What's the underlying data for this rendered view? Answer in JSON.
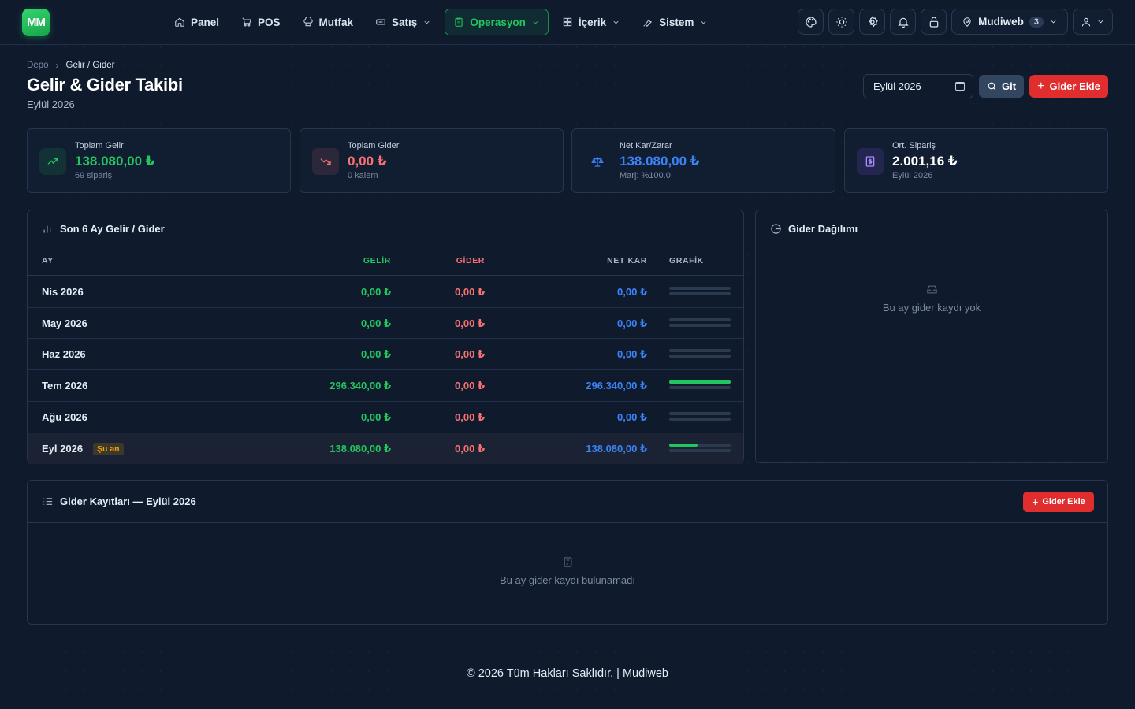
{
  "brand": {
    "logo_text": "MM",
    "accent": "#22c55e"
  },
  "nav": [
    {
      "label": "Panel",
      "icon": "home-icon",
      "has_dropdown": false,
      "active": false
    },
    {
      "label": "POS",
      "icon": "cart-icon",
      "has_dropdown": false,
      "active": false
    },
    {
      "label": "Mutfak",
      "icon": "chef-hat-icon",
      "has_dropdown": false,
      "active": false
    },
    {
      "label": "Satış",
      "icon": "ticket-icon",
      "has_dropdown": true,
      "active": false
    },
    {
      "label": "Operasyon",
      "icon": "clipboard-icon",
      "has_dropdown": true,
      "active": true
    },
    {
      "label": "İçerik",
      "icon": "grid-icon",
      "has_dropdown": true,
      "active": false
    },
    {
      "label": "Sistem",
      "icon": "wrench-icon",
      "has_dropdown": true,
      "active": false
    }
  ],
  "toolbar": {
    "icons": [
      "palette-icon",
      "sun-icon",
      "gear-icon",
      "bell-icon",
      "lock-icon"
    ],
    "branch_label": "Mudiweb",
    "branch_count": "3"
  },
  "breadcrumb": {
    "root": "Depo",
    "current": "Gelir / Gider"
  },
  "page": {
    "title": "Gelir & Gider Takibi",
    "subtitle": "Eylül 2026",
    "month_value": "Eylül 2026",
    "go_label": "Git",
    "add_label": "Gider Ekle"
  },
  "stats": [
    {
      "label": "Toplam Gelir",
      "value": "138.080,00 ₺",
      "sub": "69 sipariş",
      "color": "#22c55e",
      "icon": "trend-up-icon"
    },
    {
      "label": "Toplam Gider",
      "value": "0,00 ₺",
      "sub": "0 kalem",
      "color": "#f87171",
      "icon": "trend-down-icon"
    },
    {
      "label": "Net Kar/Zarar",
      "value": "138.080,00 ₺",
      "sub": "Marj: %100.0",
      "color": "#3b82f6",
      "icon": "scale-icon"
    },
    {
      "label": "Ort. Sipariş",
      "value": "2.001,16 ₺",
      "sub": "Eylül 2026",
      "color": "#ffffff",
      "icon": "receipt-icon"
    }
  ],
  "monthly": {
    "title": "Son 6 Ay Gelir / Gider",
    "columns": {
      "month": "AY",
      "income": "GELİR",
      "expense": "GİDER",
      "net": "NET KAR",
      "chart": "GRAFİK"
    },
    "current_badge": "Şu an",
    "rows": [
      {
        "month": "Nis 2026",
        "income": "0,00 ₺",
        "expense": "0,00 ₺",
        "net": "0,00 ₺",
        "income_ratio": 0,
        "expense_ratio": 0,
        "current": false
      },
      {
        "month": "May 2026",
        "income": "0,00 ₺",
        "expense": "0,00 ₺",
        "net": "0,00 ₺",
        "income_ratio": 0,
        "expense_ratio": 0,
        "current": false
      },
      {
        "month": "Haz 2026",
        "income": "0,00 ₺",
        "expense": "0,00 ₺",
        "net": "0,00 ₺",
        "income_ratio": 0,
        "expense_ratio": 0,
        "current": false
      },
      {
        "month": "Tem 2026",
        "income": "296.340,00 ₺",
        "expense": "0,00 ₺",
        "net": "296.340,00 ₺",
        "income_ratio": 1.0,
        "expense_ratio": 0,
        "current": false
      },
      {
        "month": "Ağu 2026",
        "income": "0,00 ₺",
        "expense": "0,00 ₺",
        "net": "0,00 ₺",
        "income_ratio": 0,
        "expense_ratio": 0,
        "current": false
      },
      {
        "month": "Eyl 2026",
        "income": "138.080,00 ₺",
        "expense": "0,00 ₺",
        "net": "138.080,00 ₺",
        "income_ratio": 0.466,
        "expense_ratio": 0,
        "current": true
      }
    ]
  },
  "distribution": {
    "title": "Gider Dağılımı",
    "empty_text": "Bu ay gider kaydı yok"
  },
  "records": {
    "title": "Gider Kayıtları — Eylül 2026",
    "add_label": "Gider Ekle",
    "empty_text": "Bu ay gider kaydı bulunamadı"
  },
  "footer": {
    "text": "© 2026 Tüm Hakları Saklıdır. | Mudiweb"
  },
  "colors": {
    "income": "#22c55e",
    "expense": "#f87171",
    "net": "#3b82f6",
    "danger": "#e02d2d"
  }
}
